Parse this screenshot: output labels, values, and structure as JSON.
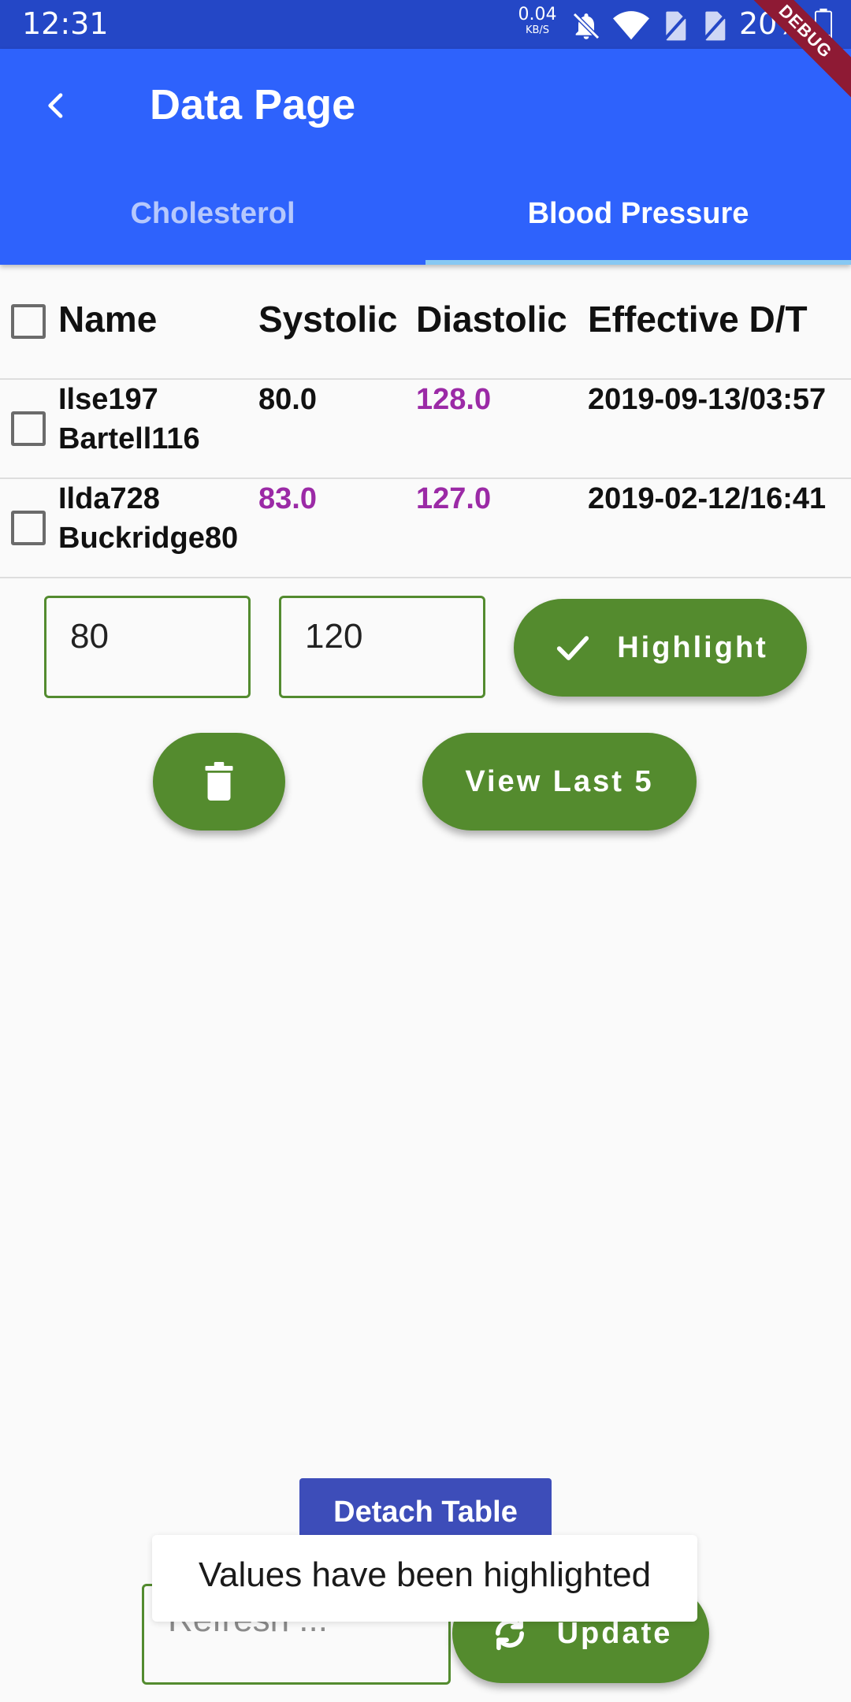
{
  "status_bar": {
    "time": "12:31",
    "net_speed_value": "0.04",
    "net_speed_unit": "KB/S",
    "battery": "20%",
    "icons": [
      "mute-icon",
      "wifi-icon",
      "no-sim-icon",
      "no-sim-icon",
      "battery-icon"
    ]
  },
  "debug_banner": "DEBUG",
  "app_bar": {
    "title": "Data Page",
    "tabs": [
      {
        "label": "Cholesterol",
        "selected": false
      },
      {
        "label": "Blood Pressure",
        "selected": true
      }
    ]
  },
  "table": {
    "columns": [
      "Name",
      "Systolic",
      "Diastolic",
      "Effective D/T"
    ],
    "rows": [
      {
        "name_line1": "Ilse197",
        "name_line2": "Bartell116",
        "systolic": "80.0",
        "systolic_highlighted": false,
        "diastolic": "128.0",
        "diastolic_highlighted": true,
        "effective": "2019-09-13/03:57"
      },
      {
        "name_line1": "Ilda728",
        "name_line2": "Buckridge80",
        "systolic": "83.0",
        "systolic_highlighted": true,
        "diastolic": "127.0",
        "diastolic_highlighted": true,
        "effective": "2019-02-12/16:41"
      }
    ]
  },
  "controls": {
    "systolic_threshold": "80",
    "diastolic_threshold": "120",
    "highlight_label": "Highlight",
    "view_last_label": "View Last 5"
  },
  "bottom": {
    "detach_label": "Detach Table",
    "refresh_placeholder": "Refresh ...",
    "update_label": "Update"
  },
  "snackbar": {
    "message": "Values have been highlighted"
  },
  "colors": {
    "status_bar": "#2447c6",
    "app_bar": "#2e62fc",
    "button_green": "#548b2e",
    "highlight_purple": "#9b2aa6",
    "detach_blue": "#3d4db9",
    "tab_indicator": "#87c8f3"
  }
}
